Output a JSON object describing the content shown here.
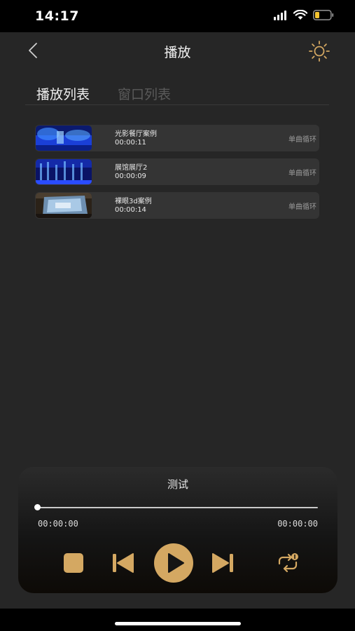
{
  "status_bar": {
    "time": "14:17"
  },
  "nav": {
    "title": "播放"
  },
  "tabs": [
    {
      "label": "播放列表",
      "active": true
    },
    {
      "label": "窗口列表",
      "active": false
    }
  ],
  "playlist": [
    {
      "title": "光影餐厅案例",
      "duration": "00:00:11",
      "mode": "单曲循环",
      "thumb_style": "blue-light"
    },
    {
      "title": "展馆展厅2",
      "duration": "00:00:09",
      "mode": "单曲循环",
      "thumb_style": "blue-hall"
    },
    {
      "title": "裸眼3d案例",
      "duration": "00:00:14",
      "mode": "单曲循环",
      "thumb_style": "street-3d"
    }
  ],
  "player": {
    "title": "测试",
    "current_time": "00:00:00",
    "total_time": "00:00:00",
    "progress": 0,
    "controls": [
      "stop-icon",
      "previous-icon",
      "play-icon",
      "next-icon",
      "loop-icon"
    ]
  },
  "colors": {
    "accent_gold": "#d4a862",
    "background": "#262626",
    "item_background": "#343434"
  }
}
